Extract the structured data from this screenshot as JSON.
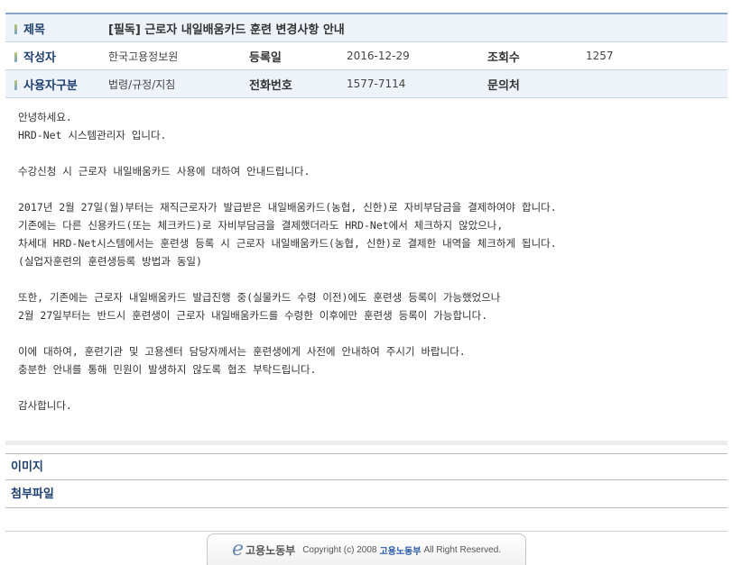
{
  "info": {
    "subject_label": "제목",
    "subject": "[필독] 근로자 내일배움카드 훈련 변경사항 안내",
    "author_label": "작성자",
    "author": "한국고용정보원",
    "date_label": "등록일",
    "date": "2016-12-29",
    "views_label": "조회수",
    "views": "1257",
    "category_label": "사용자구분",
    "category": "법령/규정/지침",
    "phone_label": "전화번호",
    "phone": "1577-7114",
    "contact_label": "문의처",
    "contact": ""
  },
  "content": {
    "lines": [
      "안녕하세요.",
      "HRD-Net 시스템관리자 입니다.",
      "",
      "수강신청 시 근로자 내일배움카드 사용에 대하여 안내드립니다.",
      "",
      "2017년 2월 27일(월)부터는 재직근로자가 발급받은 내일배움카드(농협, 신한)로 자비부담금을 결제하여야 합니다.",
      "기존에는 다른 신용카드(또는 체크카드)로 자비부담금을 결제했더라도 HRD-Net에서 체크하지 않았으나,",
      "차세대 HRD-Net시스템에서는 훈련생 등록 시 근로자 내일배움카드(농협, 신한)로 결제한 내역을 체크하게 됩니다.",
      "(실업자훈련의 훈련생등록 방법과 동일)",
      "",
      "또한, 기존에는 근로자 내일배움카드 발급진행 중(실물카드 수령 이전)에도 훈련생 등록이 가능했었으나",
      "2월 27일부터는 반드시 훈련생이 근로자 내일배움카드를 수령한 이후에만 훈련생 등록이 가능합니다.",
      "",
      "이에 대하여, 훈련기관 및 고용센터 담당자께서는 훈련생에게 사전에 안내하여 주시기 바랍니다.",
      "충분한 안내를 통해 민원이 발생하지 않도록 협조 부탁드립니다.",
      "",
      "감사합니다."
    ]
  },
  "files": {
    "image_label": "이미지",
    "attachment_label": "첨부파일"
  },
  "footer": {
    "logo_text": "고용노동부",
    "copyright_prefix": "Copyright (c) 2008",
    "ministry": "고용노동부",
    "copyright_suffix": "All Right Reserved."
  },
  "colors": {
    "label_blue": "#1f3f6e",
    "header_bg": "#eef3f9",
    "top_border": "#8aa6c8"
  }
}
